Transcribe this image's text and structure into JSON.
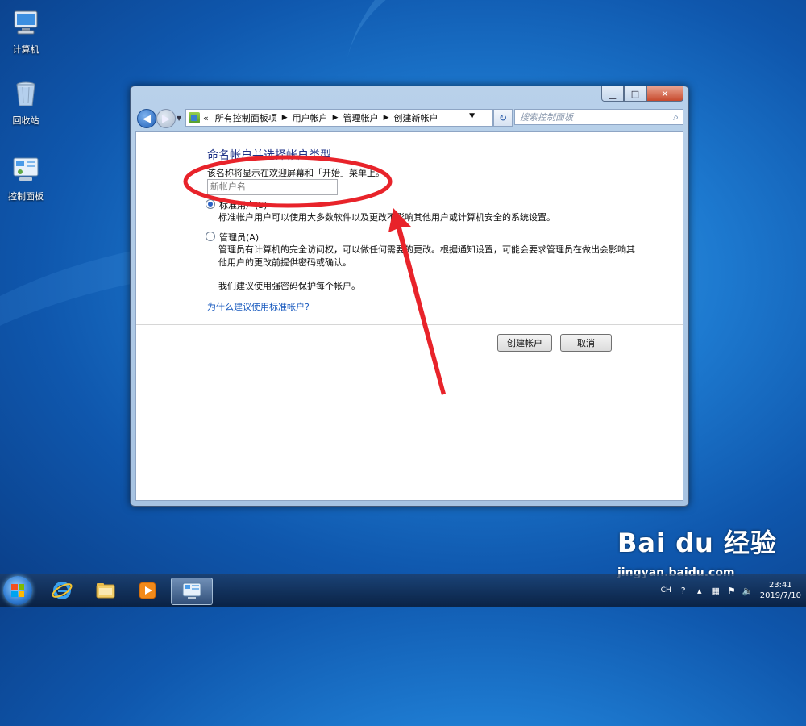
{
  "desktop": {
    "icons": [
      {
        "label": "计算机",
        "icon": "computer-icon"
      },
      {
        "label": "回收站",
        "icon": "recycle-bin-icon"
      },
      {
        "label": "控制面板",
        "icon": "control-panel-icon"
      }
    ]
  },
  "window": {
    "breadcrumb": {
      "prefix": "«",
      "items": [
        "所有控制面板项",
        "用户帐户",
        "管理帐户",
        "创建新帐户"
      ]
    },
    "search_placeholder": "搜索控制面板",
    "heading": "命名帐户并选择帐户类型",
    "hint": "该名称将显示在欢迎屏幕和「开始」菜单上。",
    "name_placeholder": "新帐户名",
    "options": [
      {
        "label": "标准用户(S)",
        "description": "标准帐户用户可以使用大多数软件以及更改不影响其他用户或计算机安全的系统设置。",
        "selected": true
      },
      {
        "label": "管理员(A)",
        "description": "管理员有计算机的完全访问权，可以做任何需要的更改。根据通知设置，可能会要求管理员在做出会影响其他用户的更改前提供密码或确认。",
        "selected": false
      }
    ],
    "advice": "我们建议使用强密码保护每个帐户。",
    "link": "为什么建议使用标准帐户?",
    "buttons": {
      "create": "创建帐户",
      "cancel": "取消"
    }
  },
  "taskbar": {
    "language": "CH",
    "time": "23:41",
    "date": "2019/7/10"
  },
  "watermark": {
    "brand": "Bai du 经验",
    "url": "jingyan.baidu.com"
  },
  "colors": {
    "annotation": "#e8232a",
    "link": "#1a5bbf",
    "heading": "#1e3287"
  }
}
